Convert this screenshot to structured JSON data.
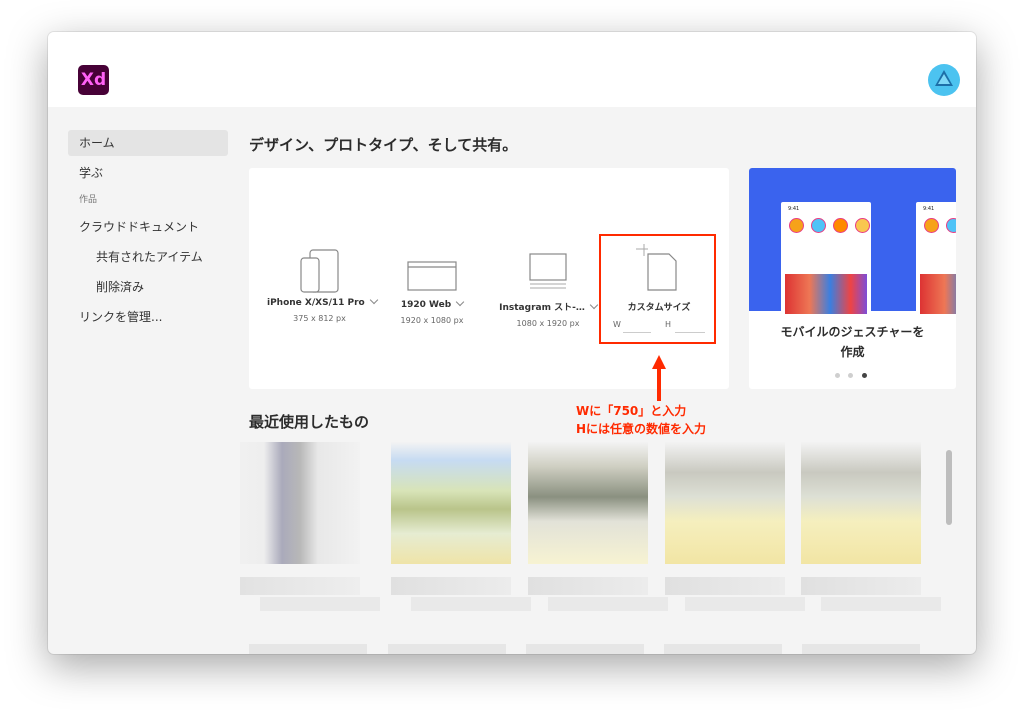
{
  "app": {
    "logo_text": "Xd",
    "accent": "#ff61f6",
    "logo_bg": "#470137"
  },
  "header": {
    "account_icon": "creative-cloud-icon"
  },
  "sidebar": {
    "items": [
      {
        "label": "ホーム",
        "active": true
      },
      {
        "label": "学ぶ"
      }
    ],
    "section_label": "作品",
    "docs_items": [
      {
        "label": "クラウドドキュメント"
      },
      {
        "label": "共有されたアイテム"
      },
      {
        "label": "削除済み"
      },
      {
        "label": "リンクを管理..."
      }
    ]
  },
  "main": {
    "heading": "デザイン、プロトタイプ、そして共有。",
    "presets": [
      {
        "label": "iPhone X/XS/11 Pro",
        "size": "375 x 812 px",
        "icon": "phone-device-icon"
      },
      {
        "label": "1920 Web",
        "size": "1920 x 1080 px",
        "icon": "web-browser-icon"
      },
      {
        "label": "Instagram スト-…",
        "size": "1080 x 1920 px",
        "icon": "instagram-story-icon"
      },
      {
        "label": "カスタムサイズ",
        "icon": "custom-size-icon"
      }
    ],
    "custom_size": {
      "w_label": "W",
      "h_label": "H",
      "w_value": "",
      "h_value": ""
    },
    "carousel": {
      "title_line1": "モバイルのジェスチャーを",
      "title_line2": "作成",
      "phone_time": "9:41",
      "dots": 3,
      "active_dot": 2,
      "banner_color": "#3a63ee"
    },
    "recent_title": "最近使用したもの"
  },
  "annotation": {
    "line1": "Wに「750」と入力",
    "line2": "Hには任意の数値を入力",
    "color": "#ff2a00"
  }
}
